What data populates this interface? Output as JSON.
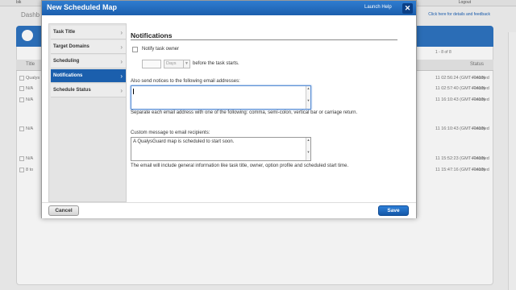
{
  "background": {
    "user_short": "bik",
    "logout": "Logout",
    "dashboard": "Dashb",
    "notice": "Click here for details and feedback",
    "pager": "1 - 8 of 8",
    "columns": {
      "title": "Title",
      "status": "Status"
    },
    "rows": [
      {
        "title": "Qualys",
        "date": "11 02:56:24 (GMT+0400)",
        "status": "Finished"
      },
      {
        "title": "N/A",
        "date": "11 02:57:40 (GMT+0400)",
        "status": "Finished"
      },
      {
        "title": "N/A",
        "date": "11 16:10:43 (GMT+0400)",
        "status": "Finished"
      },
      {
        "title": "N/A",
        "date": "11 16:10:43 (GMT+0400)",
        "status": "Finished"
      },
      {
        "title": "N/A",
        "date": "11 15:52:23 (GMT+0400)",
        "status": "Finished"
      },
      {
        "title": "8 to",
        "date": "11 15:47:16 (GMT+0400)",
        "status": "Finished"
      }
    ]
  },
  "modal": {
    "title": "New Scheduled Map",
    "launch_help": "Launch Help",
    "close_symbol": "✕",
    "sidebar": [
      {
        "label": "Task Title"
      },
      {
        "label": "Target Domains"
      },
      {
        "label": "Scheduling"
      },
      {
        "label": "Notifications"
      },
      {
        "label": "Schedule Status"
      }
    ],
    "section_title": "Notifications",
    "notify_owner_label": "Notify task owner",
    "notify_owner_checked": false,
    "notify_value": "",
    "notify_unit": "Days",
    "before_text": "before the task starts.",
    "email_label": "Also send notices to the following email addresses:",
    "email_value": "",
    "email_help": "Separate each email address with one of the following: comma, semi-colon, vertical bar or carriage return.",
    "message_label": "Custom message to email recipients:",
    "message_value": "A QualysGuard map is scheduled to start soon.",
    "message_help": "The email will include general information like task title, owner, option profile and scheduled start time.",
    "cancel_label": "Cancel",
    "save_label": "Save"
  },
  "colors": {
    "header_blue": "#1b5fad",
    "active_nav": "#1b5fad",
    "save_blue": "#1558a8"
  }
}
